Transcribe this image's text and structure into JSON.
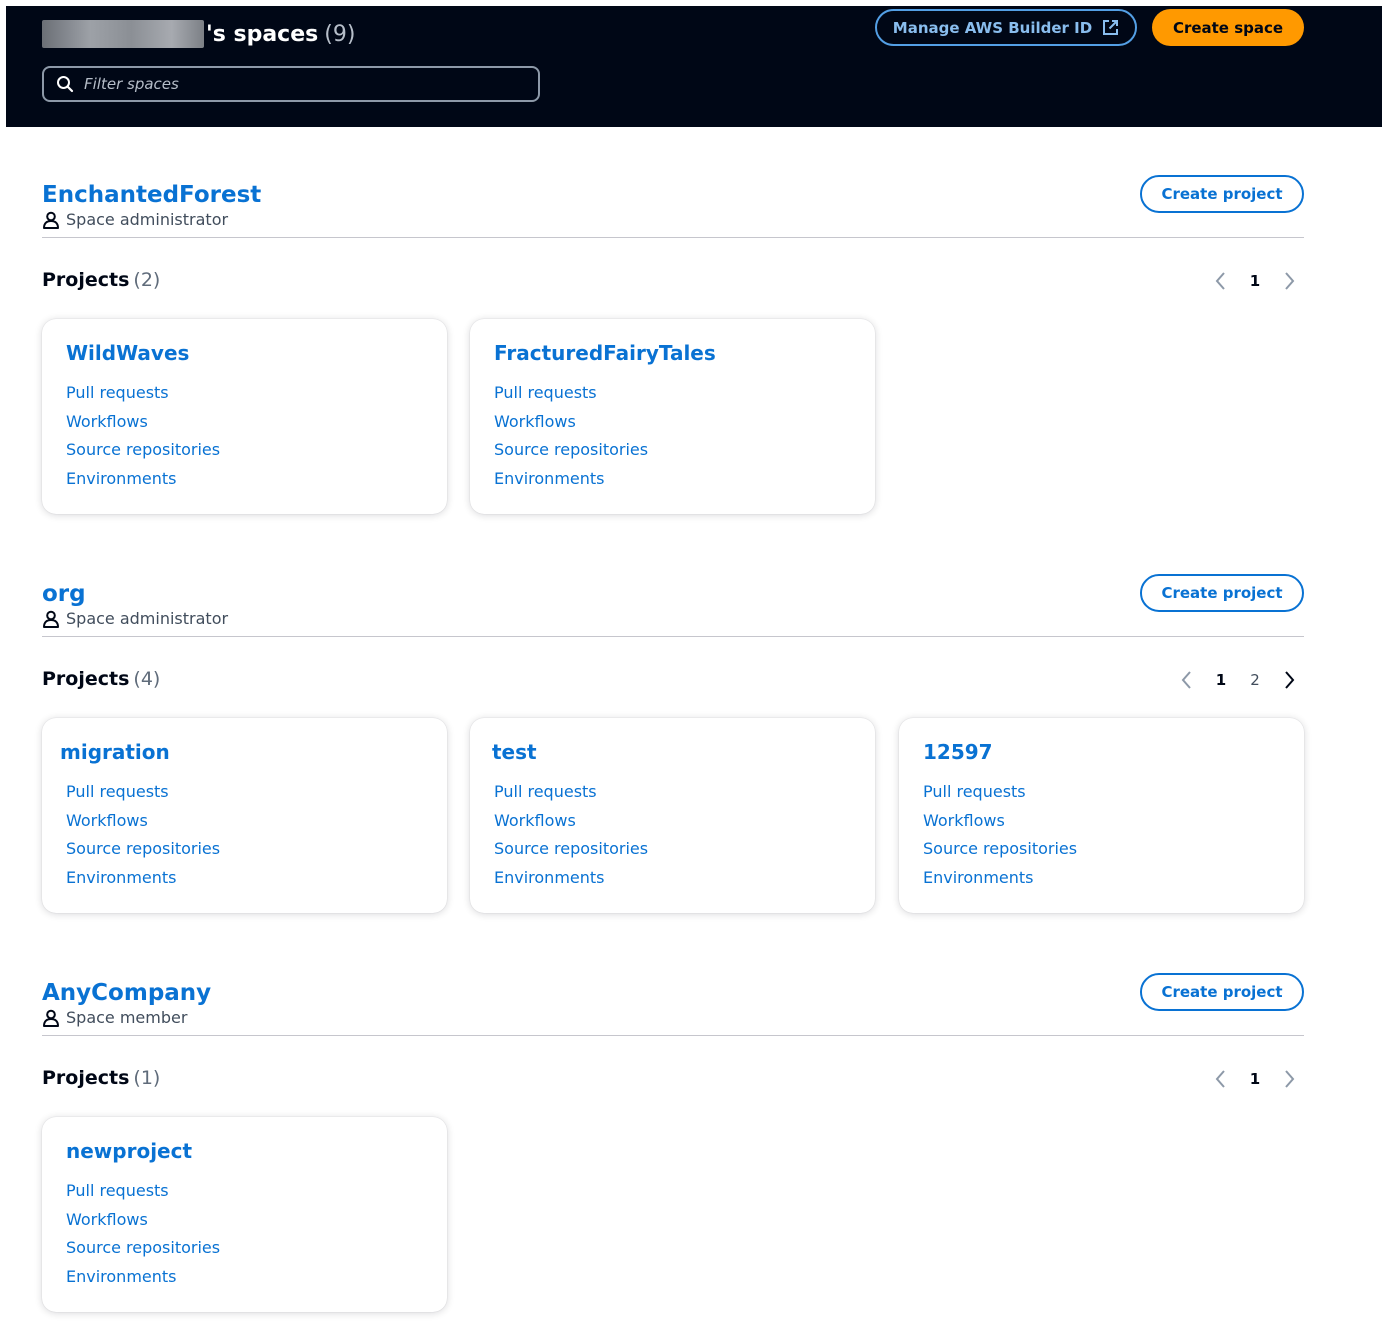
{
  "header": {
    "title_suffix": "'s spaces",
    "count": "(9)",
    "filter_placeholder": "Filter spaces",
    "manage_label": "Manage AWS Builder ID",
    "create_space_label": "Create space"
  },
  "project_links": [
    "Pull requests",
    "Workflows",
    "Source repositories",
    "Environments"
  ],
  "spaces": [
    {
      "name": "EnchantedForest",
      "role": "Space administrator",
      "create_project_label": "Create project",
      "projects_label": "Projects",
      "projects_count": "(2)",
      "pages": [
        "1"
      ],
      "projects": [
        {
          "name": "WildWaves"
        },
        {
          "name": "FracturedFairyTales"
        }
      ]
    },
    {
      "name": "org",
      "role": "Space administrator",
      "create_project_label": "Create project",
      "projects_label": "Projects",
      "projects_count": "(4)",
      "pages": [
        "1",
        "2"
      ],
      "projects": [
        {
          "name": "migration"
        },
        {
          "name": "test"
        },
        {
          "name": "12597"
        }
      ]
    },
    {
      "name": "AnyCompany",
      "role": "Space member",
      "create_project_label": "Create project",
      "projects_label": "Projects",
      "projects_count": "(1)",
      "pages": [
        "1"
      ],
      "projects": [
        {
          "name": "newproject"
        }
      ]
    }
  ],
  "colors": {
    "header_bg": "#000716",
    "link_blue": "#0972d3",
    "primary_orange": "#ff9900"
  }
}
